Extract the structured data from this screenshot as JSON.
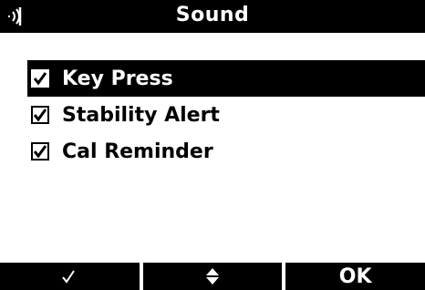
{
  "header": {
    "icon": "speaker-icon",
    "title": "Sound"
  },
  "options": [
    {
      "label": "Key Press",
      "checked": true,
      "selected": true
    },
    {
      "label": "Stability Alert",
      "checked": true,
      "selected": false
    },
    {
      "label": "Cal Reminder",
      "checked": true,
      "selected": false
    }
  ],
  "softkeys": {
    "left_icon": "checkmark-icon",
    "middle_icon": "up-down-arrows-icon",
    "right_label": "OK"
  },
  "colors": {
    "background": "#ffffff",
    "bar": "#000000",
    "text_on_bar": "#ffffff"
  }
}
